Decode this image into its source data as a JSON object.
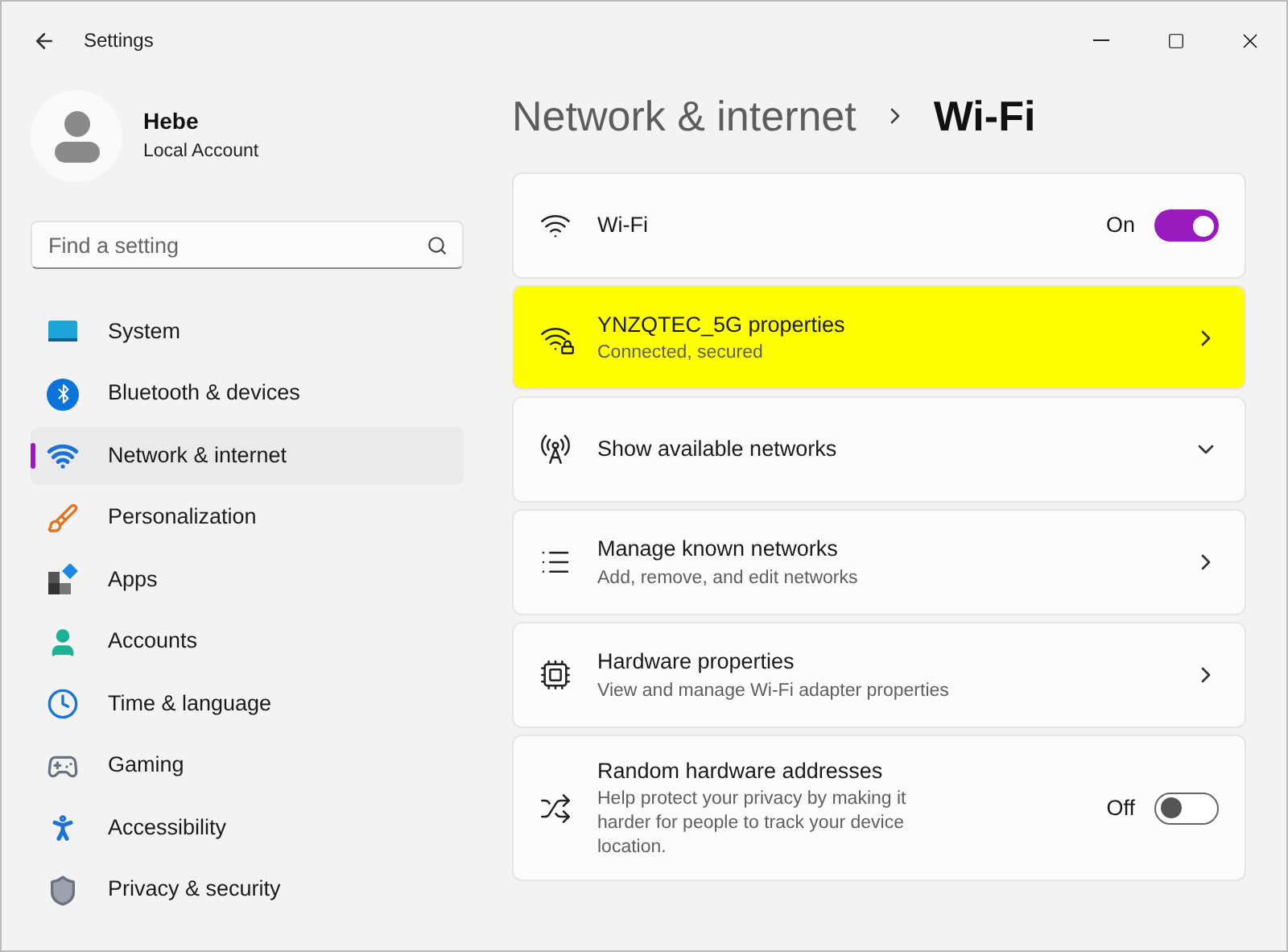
{
  "window": {
    "title": "Settings"
  },
  "account": {
    "name": "Hebe",
    "type": "Local Account"
  },
  "search": {
    "placeholder": "Find a setting"
  },
  "sidebar": {
    "items": [
      {
        "label": "System",
        "selected": false
      },
      {
        "label": "Bluetooth & devices",
        "selected": false
      },
      {
        "label": "Network & internet",
        "selected": true
      },
      {
        "label": "Personalization",
        "selected": false
      },
      {
        "label": "Apps",
        "selected": false
      },
      {
        "label": "Accounts",
        "selected": false
      },
      {
        "label": "Time & language",
        "selected": false
      },
      {
        "label": "Gaming",
        "selected": false
      },
      {
        "label": "Accessibility",
        "selected": false
      },
      {
        "label": "Privacy & security",
        "selected": false
      }
    ]
  },
  "breadcrumb": {
    "parent": "Network & internet",
    "current": "Wi-Fi"
  },
  "settings": [
    {
      "kind": "toggle",
      "title": "Wi-Fi",
      "state_label": "On",
      "on": true,
      "highlighted": false
    },
    {
      "kind": "link",
      "title": "YNZQTEC_5G properties",
      "description": "Connected, secured",
      "highlighted": true
    },
    {
      "kind": "expand",
      "title": "Show available networks",
      "highlighted": false
    },
    {
      "kind": "link",
      "title": "Manage known networks",
      "description": "Add, remove, and edit networks",
      "highlighted": false
    },
    {
      "kind": "link",
      "title": "Hardware properties",
      "description": "View and manage Wi-Fi adapter properties",
      "highlighted": false
    },
    {
      "kind": "toggle",
      "title": "Random hardware addresses",
      "description": "Help protect your privacy by making it harder for people to track your device location.",
      "state_label": "Off",
      "on": false,
      "highlighted": false
    }
  ]
}
